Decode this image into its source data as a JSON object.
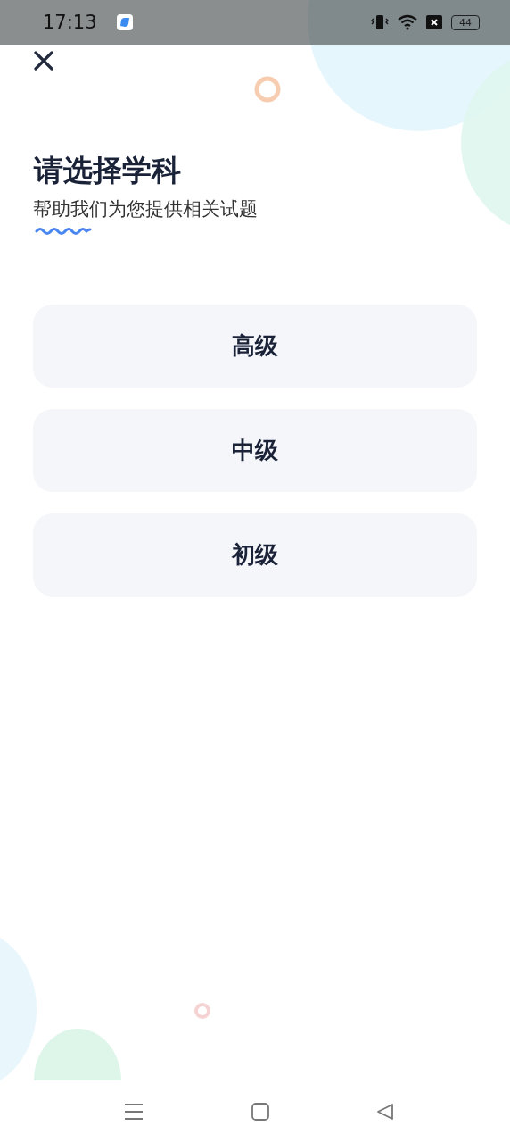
{
  "status_bar": {
    "time": "17:13",
    "battery": "44"
  },
  "title": "请选择学科",
  "subtitle": "帮助我们为您提供相关试题",
  "options": [
    {
      "label": "高级"
    },
    {
      "label": "中级"
    },
    {
      "label": "初级"
    }
  ]
}
